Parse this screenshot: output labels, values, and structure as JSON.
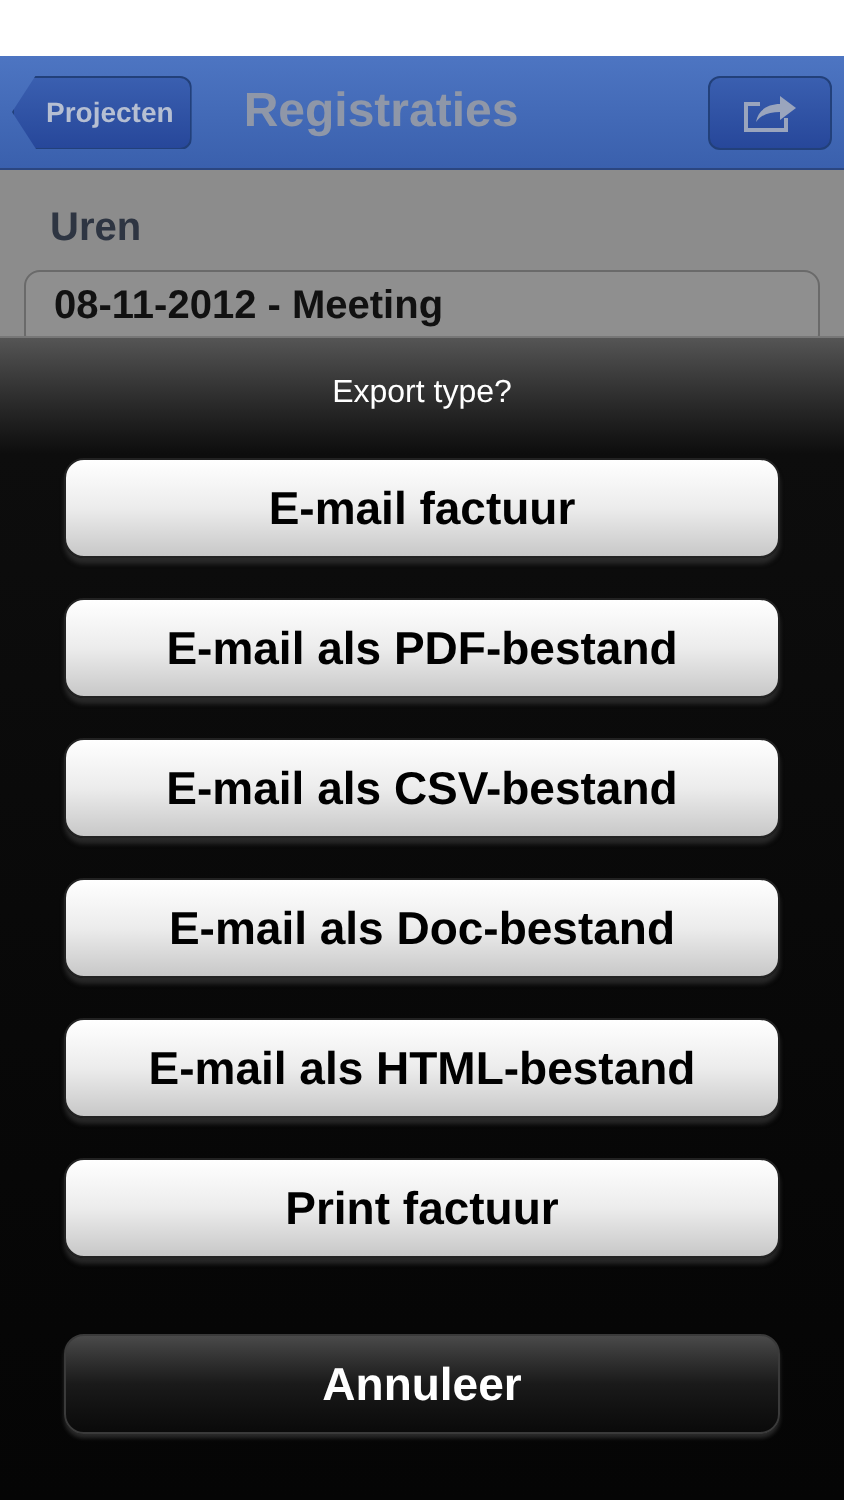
{
  "nav_bar": {
    "back_button": "Projecten",
    "title": "Registraties"
  },
  "content": {
    "section_header": "Uren",
    "entry": "08-11-2012 - Meeting"
  },
  "action_sheet": {
    "title": "Export type?",
    "buttons": [
      {
        "label": "E-mail factuur",
        "kind": "default"
      },
      {
        "label": "E-mail als PDF-bestand",
        "kind": "default"
      },
      {
        "label": "E-mail als CSV-bestand",
        "kind": "default"
      },
      {
        "label": "E-mail als Doc-bestand",
        "kind": "default"
      },
      {
        "label": "E-mail als HTML-bestand",
        "kind": "default"
      },
      {
        "label": "Print factuur",
        "kind": "default"
      },
      {
        "label": "Annuleer",
        "kind": "cancel"
      }
    ]
  }
}
